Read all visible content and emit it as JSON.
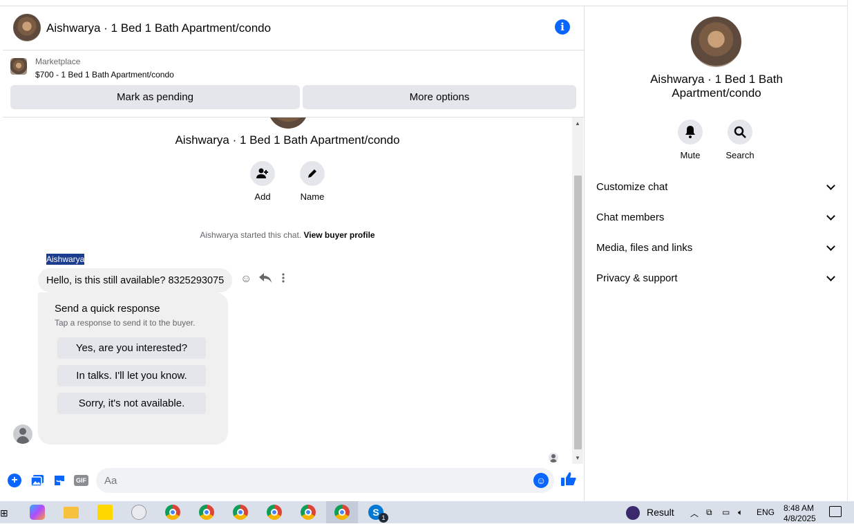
{
  "header": {
    "title": "Aishwarya · 1 Bed 1 Bath Apartment/condo",
    "info_icon": "info-icon"
  },
  "marketplace": {
    "label": "Marketplace",
    "listing": "$700 - 1 Bed 1 Bath Apartment/condo",
    "buttons": {
      "pending": "Mark as pending",
      "more": "More options"
    }
  },
  "thread": {
    "title": "Aishwarya · 1 Bed 1 Bath Apartment/condo",
    "actions": {
      "add": "Add",
      "name": "Name"
    },
    "started_text": "Aishwarya started this chat.",
    "view_profile": "View buyer profile",
    "sender": "Aishwarya",
    "message": "Hello, is this still available? 8325293075",
    "quick_response": {
      "title": "Send a quick response",
      "subtitle": "Tap a response to send it to the buyer.",
      "options": [
        "Yes, are you interested?",
        "In talks. I'll let you know.",
        "Sorry, it's not available."
      ]
    }
  },
  "composer": {
    "placeholder": "Aa",
    "gif_label": "GIF"
  },
  "sidebar": {
    "name": "Aishwarya · 1 Bed 1 Bath Apartment/condo",
    "actions": {
      "mute": "Mute",
      "search": "Search"
    },
    "sections": [
      "Customize chat",
      "Chat members",
      "Media, files and links",
      "Privacy & support"
    ]
  },
  "taskbar": {
    "result_label": "Result",
    "language": "ENG",
    "time": "8:48 AM",
    "date": "4/8/2025",
    "skype_badge": "1"
  },
  "colors": {
    "accent": "#0866ff",
    "button_gray": "#e4e6eb",
    "bubble": "#f0f0f0"
  }
}
